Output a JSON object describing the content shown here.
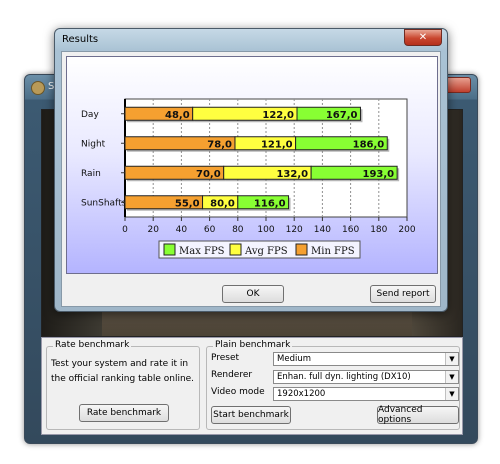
{
  "launcher": {
    "title": "S",
    "rate_group": {
      "legend": "Rate benchmark",
      "description": "Test your system and rate it in the official ranking table online.",
      "button": "Rate benchmark"
    },
    "plain_group": {
      "legend": "Plain benchmark",
      "preset_label": "Preset",
      "preset_value": "Medium",
      "renderer_label": "Renderer",
      "renderer_value": "Enhan. full dyn. lighting (DX10)",
      "video_label": "Video mode",
      "video_value": "1920x1200",
      "start_button": "Start benchmark",
      "advanced_button": "Advanced options"
    }
  },
  "results_dialog": {
    "title": "Results",
    "close_glyph": "✕",
    "ok_button": "OK",
    "send_button": "Send report"
  },
  "chart_data": {
    "type": "bar",
    "orientation": "horizontal",
    "stacked": true,
    "categories": [
      "Day",
      "Night",
      "Rain",
      "SunShafts"
    ],
    "series": [
      {
        "name": "Min FPS",
        "values": [
          48.0,
          78.0,
          70.0,
          55.0
        ],
        "labels": [
          "48,0",
          "78,0",
          "70,0",
          "55,0"
        ],
        "color": "#f5a030"
      },
      {
        "name": "Avg FPS",
        "values": [
          122.0,
          121.0,
          132.0,
          80.0
        ],
        "labels": [
          "122,0",
          "121,0",
          "132,0",
          "80,0"
        ],
        "color": "#ffff40"
      },
      {
        "name": "Max FPS",
        "values": [
          167.0,
          186.0,
          193.0,
          116.0
        ],
        "labels": [
          "167,0",
          "186,0",
          "193,0",
          "116,0"
        ],
        "color": "#88ff33"
      }
    ],
    "xlim": [
      0,
      200
    ],
    "xticks": [
      "0",
      "20",
      "40",
      "60",
      "80",
      "100",
      "120",
      "140",
      "160",
      "180",
      "200"
    ],
    "grid": true,
    "legend_position": "bottom",
    "legend_order": [
      "Max FPS",
      "Avg FPS",
      "Min FPS"
    ]
  }
}
